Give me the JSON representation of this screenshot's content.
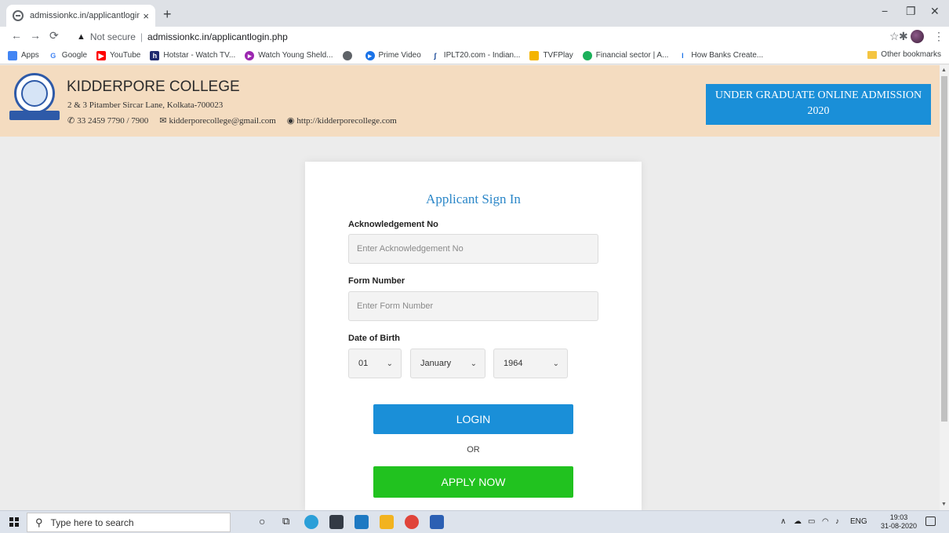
{
  "browser": {
    "tab_title": "admissionkc.in/applicantlogin.ph",
    "tab_close": "×",
    "new_tab": "+",
    "security_label": "Not secure",
    "url": "admissionkc.in/applicantlogin.php",
    "bookmarks": [
      {
        "label": "Apps",
        "color": "#4285f4"
      },
      {
        "label": "Google",
        "color": "#4285f4"
      },
      {
        "label": "YouTube",
        "color": "#ff0000"
      },
      {
        "label": "Hotstar - Watch TV...",
        "color": "#1f2a6e"
      },
      {
        "label": "Watch Young Sheld...",
        "color": "#9c27b0"
      },
      {
        "label": "",
        "color": "#5f6368"
      },
      {
        "label": "Prime Video",
        "color": "#1a73e8"
      },
      {
        "label": "IPLT20.com - Indian...",
        "color": "#0a3d91"
      },
      {
        "label": "TVFPlay",
        "color": "#f4b400"
      },
      {
        "label": "Financial sector | A...",
        "color": "#1bb05a"
      },
      {
        "label": "How Banks Create...",
        "color": "#1a73e8"
      }
    ],
    "other_bookmarks": "Other bookmarks"
  },
  "header": {
    "college_name": "KIDDERPORE COLLEGE",
    "address": "2 & 3 Pitamber Sircar Lane, Kolkata-700023",
    "phone": "33 2459 7790 / 7900",
    "email": "kidderporecollege@gmail.com",
    "website": "http://kidderporecollege.com",
    "admission_line1": "UNDER GRADUATE ONLINE ADMISSION",
    "admission_line2": "2020"
  },
  "signin": {
    "title": "Applicant Sign In",
    "ack_label": "Acknowledgement No",
    "ack_placeholder": "Enter Acknowledgement No",
    "form_label": "Form Number",
    "form_placeholder": "Enter Form Number",
    "dob_label": "Date of Birth",
    "dob_day": "01",
    "dob_month": "January",
    "dob_year": "1964",
    "login_label": "LOGIN",
    "or_label": "OR",
    "apply_label": "APPLY NOW"
  },
  "taskbar": {
    "search_placeholder": "Type here to search",
    "language": "ENG",
    "time": "19:03",
    "date": "31-08-2020"
  }
}
